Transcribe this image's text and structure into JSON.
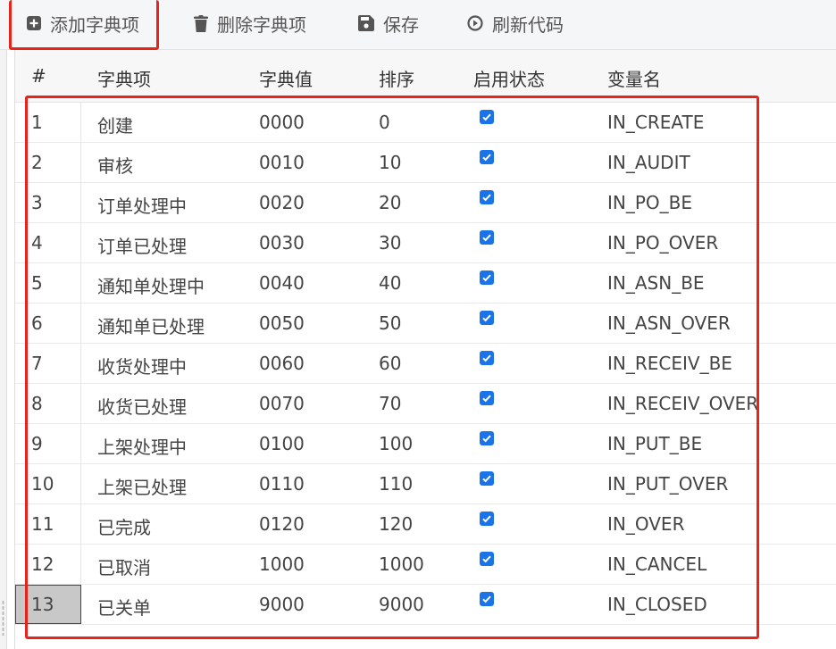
{
  "toolbar": {
    "add_label": "添加字典项",
    "delete_label": "删除字典项",
    "save_label": "保存",
    "refresh_label": "刷新代码"
  },
  "table": {
    "headers": [
      "#",
      "字典项",
      "字典值",
      "排序",
      "启用状态",
      "变量名"
    ],
    "rows": [
      {
        "idx": "1",
        "item": "创建",
        "value": "0000",
        "sort": "0",
        "enabled": true,
        "var": "IN_CREATE"
      },
      {
        "idx": "2",
        "item": "审核",
        "value": "0010",
        "sort": "10",
        "enabled": true,
        "var": "IN_AUDIT"
      },
      {
        "idx": "3",
        "item": "订单处理中",
        "value": "0020",
        "sort": "20",
        "enabled": true,
        "var": "IN_PO_BE"
      },
      {
        "idx": "4",
        "item": "订单已处理",
        "value": "0030",
        "sort": "30",
        "enabled": true,
        "var": "IN_PO_OVER"
      },
      {
        "idx": "5",
        "item": "通知单处理中",
        "value": "0040",
        "sort": "40",
        "enabled": true,
        "var": "IN_ASN_BE"
      },
      {
        "idx": "6",
        "item": "通知单已处理",
        "value": "0050",
        "sort": "50",
        "enabled": true,
        "var": "IN_ASN_OVER"
      },
      {
        "idx": "7",
        "item": "收货处理中",
        "value": "0060",
        "sort": "60",
        "enabled": true,
        "var": "IN_RECEIV_BE"
      },
      {
        "idx": "8",
        "item": "收货已处理",
        "value": "0070",
        "sort": "70",
        "enabled": true,
        "var": "IN_RECEIV_OVER"
      },
      {
        "idx": "9",
        "item": "上架处理中",
        "value": "0100",
        "sort": "100",
        "enabled": true,
        "var": "IN_PUT_BE"
      },
      {
        "idx": "10",
        "item": "上架已处理",
        "value": "0110",
        "sort": "110",
        "enabled": true,
        "var": "IN_PUT_OVER"
      },
      {
        "idx": "11",
        "item": "已完成",
        "value": "0120",
        "sort": "120",
        "enabled": true,
        "var": "IN_OVER"
      },
      {
        "idx": "12",
        "item": "已取消",
        "value": "1000",
        "sort": "1000",
        "enabled": true,
        "var": "IN_CANCEL"
      },
      {
        "idx": "13",
        "item": "已关单",
        "value": "9000",
        "sort": "9000",
        "enabled": true,
        "var": "IN_CLOSED"
      }
    ]
  },
  "colors": {
    "highlight": "#e8231b",
    "checkbox": "#1a73e8",
    "selected_index": "#c8c8c8"
  },
  "icons": {
    "add": "plus-square-icon",
    "delete": "trash-icon",
    "save": "floppy-disk-icon",
    "refresh": "play-circle-icon"
  }
}
